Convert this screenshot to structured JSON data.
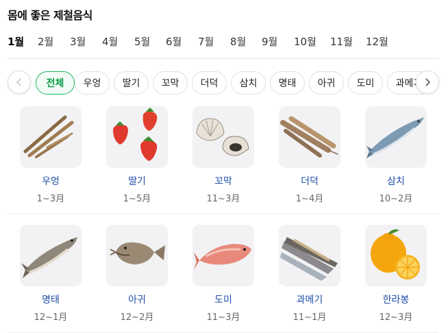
{
  "page": {
    "title": "몸에 좋은 제철음식"
  },
  "months": [
    {
      "label": "1월",
      "active": true
    },
    {
      "label": "2월"
    },
    {
      "label": "3월"
    },
    {
      "label": "4월"
    },
    {
      "label": "5월"
    },
    {
      "label": "6월"
    },
    {
      "label": "7월"
    },
    {
      "label": "8월"
    },
    {
      "label": "9월"
    },
    {
      "label": "10월"
    },
    {
      "label": "11월"
    },
    {
      "label": "12월"
    }
  ],
  "filters": {
    "prev_icon": "chevron-left-icon",
    "next_icon": "chevron-right-icon",
    "chips": [
      {
        "label": "전체",
        "active": true
      },
      {
        "label": "우엉"
      },
      {
        "label": "딸기"
      },
      {
        "label": "꼬막"
      },
      {
        "label": "더덕"
      },
      {
        "label": "삼치"
      },
      {
        "label": "명태"
      },
      {
        "label": "아귀"
      },
      {
        "label": "도미"
      },
      {
        "label": "과메기"
      }
    ]
  },
  "foods": [
    {
      "name": "우엉",
      "season": "1~3月",
      "image": "burdock-image"
    },
    {
      "name": "딸기",
      "season": "1~5月",
      "image": "strawberry-image"
    },
    {
      "name": "꼬막",
      "season": "11~3月",
      "image": "cockle-image"
    },
    {
      "name": "더덕",
      "season": "1~4月",
      "image": "deodeok-root-image"
    },
    {
      "name": "삼치",
      "season": "10~2月",
      "image": "spanish-mackerel-image"
    },
    {
      "name": "명태",
      "season": "12~1月",
      "image": "pollack-image"
    },
    {
      "name": "아귀",
      "season": "12~2月",
      "image": "monkfish-image"
    },
    {
      "name": "도미",
      "season": "11~3月",
      "image": "sea-bream-image"
    },
    {
      "name": "과메기",
      "season": "11~1月",
      "image": "gwamegi-image"
    },
    {
      "name": "한라봉",
      "season": "12~3月",
      "image": "hallabong-image"
    }
  ],
  "colors": {
    "accent": "#19b85a",
    "link": "#1f4ea8",
    "season_text": "#666666"
  }
}
